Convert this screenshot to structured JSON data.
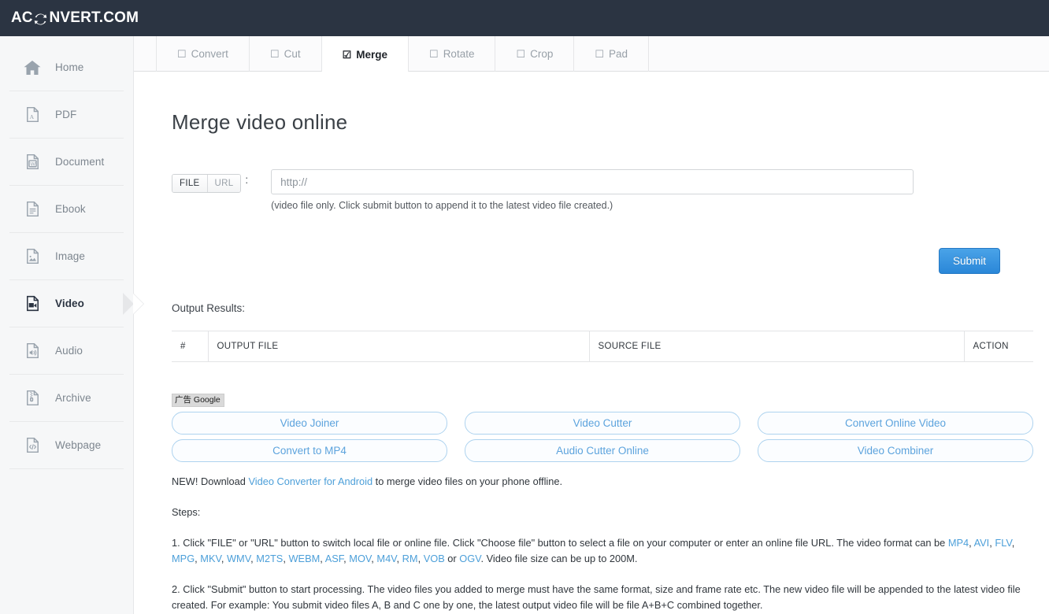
{
  "header": {
    "logo_prefix": "AC",
    "logo_icon": "circular-arrows-icon",
    "logo_suffix": "NVERT.COM",
    "bg_color": "#2b3442"
  },
  "sidebar": {
    "items": [
      {
        "label": "Home",
        "icon": "home-icon",
        "active": false
      },
      {
        "label": "PDF",
        "icon": "pdf-file-icon",
        "active": false
      },
      {
        "label": "Document",
        "icon": "word-doc-icon",
        "active": false
      },
      {
        "label": "Ebook",
        "icon": "ebook-icon",
        "active": false
      },
      {
        "label": "Image",
        "icon": "image-icon",
        "active": false
      },
      {
        "label": "Video",
        "icon": "video-icon",
        "active": true
      },
      {
        "label": "Audio",
        "icon": "audio-icon",
        "active": false
      },
      {
        "label": "Archive",
        "icon": "archive-icon",
        "active": false
      },
      {
        "label": "Webpage",
        "icon": "webpage-icon",
        "active": false
      }
    ]
  },
  "tabs": [
    {
      "label": "Convert",
      "checkbox": "☐",
      "active": false
    },
    {
      "label": "Cut",
      "checkbox": "☐",
      "active": false
    },
    {
      "label": "Merge",
      "checkbox": "☑",
      "active": true
    },
    {
      "label": "Rotate",
      "checkbox": "☐",
      "active": false
    },
    {
      "label": "Crop",
      "checkbox": "☐",
      "active": false
    },
    {
      "label": "Pad",
      "checkbox": "☐",
      "active": false
    }
  ],
  "main": {
    "title": "Merge video online",
    "source_toggle": {
      "file_label": "FILE",
      "url_label": "URL",
      "selected": "FILE",
      "colon": ":"
    },
    "url_field": {
      "value": "",
      "placeholder": "http://"
    },
    "field_note": "(video file only. Click submit button to append it to the latest video file created.)",
    "submit_label": "Submit",
    "submit_color": "#2a87d8",
    "output_label": "Output Results:",
    "table": {
      "columns": [
        "#",
        "OUTPUT FILE",
        "SOURCE FILE",
        "ACTION"
      ],
      "rows": []
    }
  },
  "ads": {
    "label": "广告 Google",
    "buttons": [
      "Video Joiner",
      "Video Cutter",
      "Convert Online Video",
      "Convert to MP4",
      "Audio Cutter Online",
      "Video Combiner"
    ]
  },
  "copy": {
    "promo_prefix": "NEW! Download ",
    "promo_link": "Video Converter for Android",
    "promo_suffix": " to merge video files on your phone offline.",
    "steps_heading": "Steps:",
    "step1_a": "1. Click \"FILE\" or \"URL\" button to switch local file or online file. Click \"Choose file\" button to select a file on your computer or enter an online file URL. The video format can be ",
    "step1_formats_1": "MP4",
    "step1_formats_2": "AVI",
    "step1_formats_3": "FLV",
    "step1_formats_4": "MPG",
    "step1_formats_5": "MKV",
    "step1_formats_6": "WMV",
    "step1_formats_7": "M2TS",
    "step1_formats_8": "WEBM",
    "step1_formats_9": "ASF",
    "step1_formats_10": "MOV",
    "step1_formats_11": "M4V",
    "step1_formats_12": "RM",
    "step1_formats_13": "VOB",
    "step1_or": " or ",
    "step1_formats_14": "OGV",
    "step1_b": ". Video file size can be up to 200M.",
    "step2": "2. Click \"Submit\" button to start processing. The video files you added to merge must have the same format, size and frame rate etc. The new video file will be appended to the latest video file created. For example: You submit video files A, B and C one by one, the latest output video file will be file A+B+C combined together."
  }
}
